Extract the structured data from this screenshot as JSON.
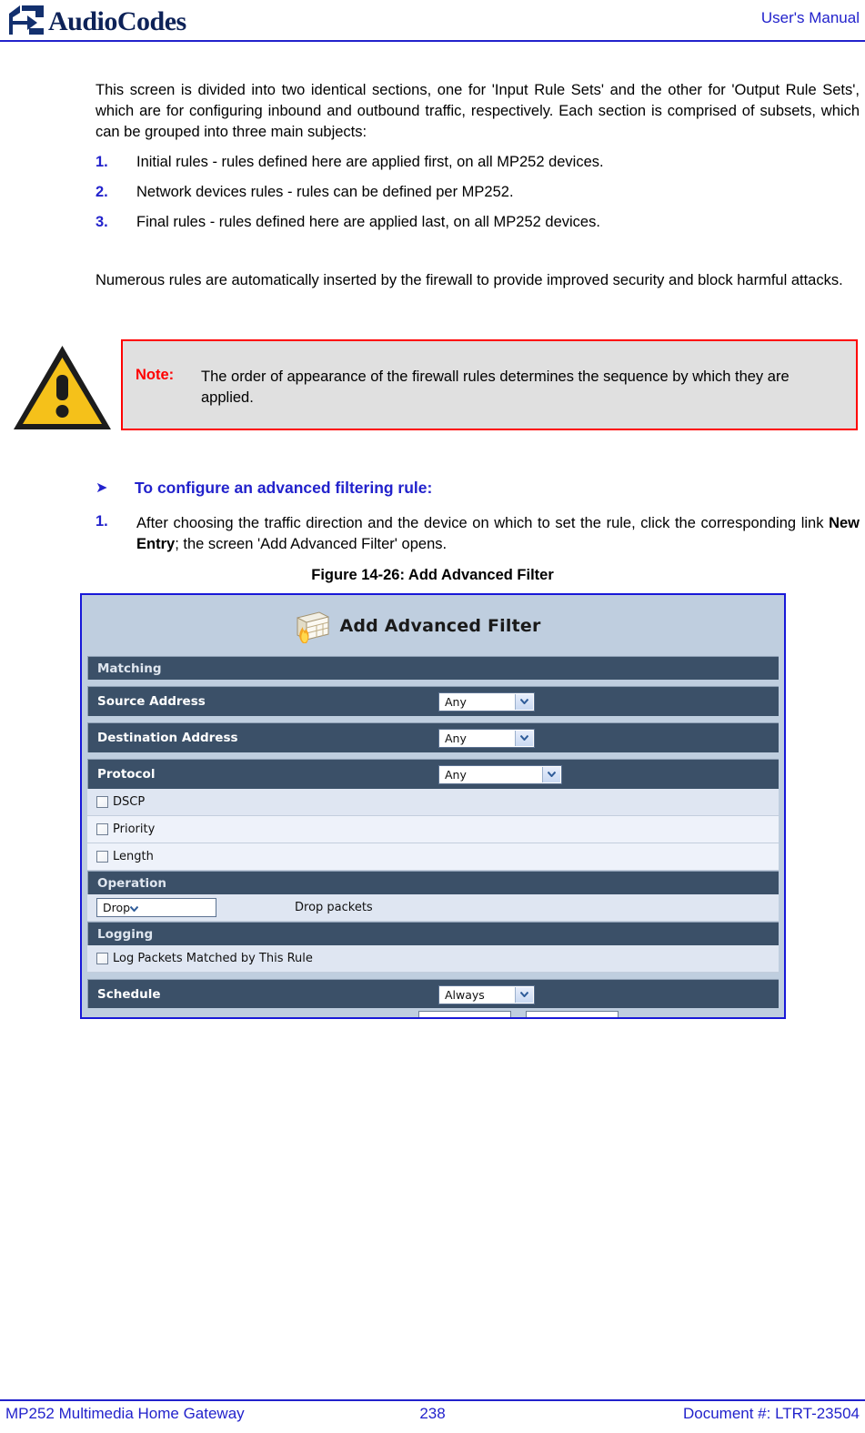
{
  "header": {
    "brand": "AudioCodes",
    "doc_type": "User's Manual"
  },
  "body": {
    "intro_paragraph": "This screen is divided into two identical sections, one for 'Input Rule Sets' and the other for 'Output Rule Sets', which are for configuring inbound and outbound traffic, respectively. Each section is comprised of subsets, which can be grouped into three main subjects:",
    "subjects": [
      {
        "num": "1.",
        "text": "Initial rules - rules defined here are applied first, on all MP252 devices."
      },
      {
        "num": "2.",
        "text": "Network devices rules - rules can be defined per MP252."
      },
      {
        "num": "3.",
        "text": "Final rules - rules defined here are applied last, on all MP252 devices."
      }
    ],
    "second_paragraph": "Numerous rules are automatically inserted by the firewall to provide improved security and block harmful attacks."
  },
  "note": {
    "label": "Note:",
    "text": "The order of appearance of the firewall rules determines the sequence by which they are applied.",
    "icon": "warning-triangle-icon",
    "border_color": "#ff0000",
    "background_color": "#e0e0e0"
  },
  "procedure": {
    "arrow": "➤",
    "heading": "To configure an advanced filtering rule:",
    "step_num": "1.",
    "step_text_before_bold": "After choosing the traffic direction and the device on which to set the rule, click the corresponding link ",
    "step_bold": "New Entry",
    "step_text_after_bold": "; the screen 'Add Advanced Filter' opens."
  },
  "figure": {
    "caption": "Figure 14-26: Add Advanced Filter",
    "title": "Add Advanced Filter",
    "title_icon": "firewall-icon",
    "sections": {
      "matching": {
        "header": "Matching",
        "rows": [
          {
            "label": "Source Address",
            "value": "Any",
            "width": "sm"
          },
          {
            "label": "Destination Address",
            "value": "Any",
            "width": "sm"
          },
          {
            "label": "Protocol",
            "value": "Any",
            "width": "md"
          }
        ],
        "checkboxes": [
          {
            "label": "DSCP",
            "checked": false
          },
          {
            "label": "Priority",
            "checked": false
          },
          {
            "label": "Length",
            "checked": false
          }
        ]
      },
      "operation": {
        "header": "Operation",
        "select_value": "Drop",
        "description": "Drop packets"
      },
      "logging": {
        "header": "Logging",
        "checkbox_label": "Log Packets Matched by This Rule",
        "checked": false
      },
      "schedule": {
        "label": "Schedule",
        "value": "Always"
      }
    },
    "colors": {
      "window_bg": "#bfcedf",
      "section_header_bg": "#3b5068",
      "row_light_bg": "#dfe6f2",
      "border": "#1818d8"
    }
  },
  "footer": {
    "left": "MP252 Multimedia Home Gateway",
    "page_number": "238",
    "right": "Document #: LTRT-23504"
  }
}
